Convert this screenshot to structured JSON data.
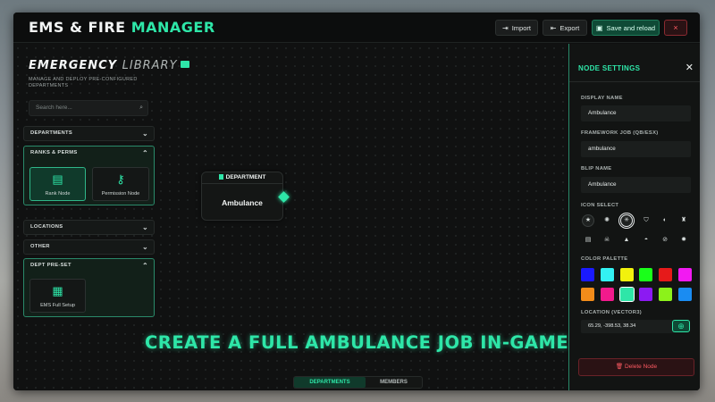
{
  "header": {
    "title_main": "EMS & FIRE",
    "title_accent": "MANAGER",
    "import_label": "Import",
    "export_label": "Export",
    "save_label": "Save and reload",
    "close_label": "×"
  },
  "library": {
    "title_bold": "EMERGENCY",
    "title_thin": "LIBRARY",
    "subtitle": "MANAGE AND DEPLOY PRE-CONFIGURED DEPARTMENTS",
    "search_placeholder": "Search here...",
    "sections": [
      {
        "label": "DEPARTMENTS",
        "open": false
      },
      {
        "label": "RANKS & PERMS",
        "open": true,
        "tiles": [
          {
            "label": "Rank Node",
            "icon": "badge-icon"
          },
          {
            "label": "Permission Node",
            "icon": "key-icon"
          }
        ]
      },
      {
        "label": "LOCATIONS",
        "open": false
      },
      {
        "label": "OTHER",
        "open": false
      },
      {
        "label": "DEPT PRE-SET",
        "open": true,
        "tiles": [
          {
            "label": "EMS Full Setup",
            "icon": "building-check-icon"
          }
        ]
      }
    ]
  },
  "node": {
    "header": "DEPARTMENT",
    "name": "Ambulance"
  },
  "caption": "CREATE A FULL AMBULANCE JOB IN-GAME",
  "settings": {
    "title": "NODE SETTINGS",
    "close": "✕",
    "display_name_label": "DISPLAY NAME",
    "display_name_value": "Ambulance",
    "framework_job_label": "FRAMEWORK JOB (QB/ESX)",
    "framework_job_value": "ambulance",
    "blip_name_label": "BLIP NAME",
    "blip_name_value": "Ambulance",
    "icon_select_label": "ICON SELECT",
    "icons": [
      "star-badge-icon",
      "gear-icon",
      "ambulance-icon",
      "shield-icon",
      "half-shield-icon",
      "crown-icon",
      "document-icon",
      "skull-icon",
      "alert-triangle-icon",
      "helmet-icon",
      "pills-icon",
      "cog-icon"
    ],
    "selected_icon": 2,
    "color_palette_label": "COLOR PALETTE",
    "colors": [
      "#1a1aff",
      "#33f2f2",
      "#f2f20d",
      "#1aff1a",
      "#e61a1a",
      "#f21af2",
      "#f28c1a",
      "#f21a8c",
      "#2ee6a8",
      "#8c1af2",
      "#8cf21a",
      "#1a8cf2"
    ],
    "selected_color": 8,
    "location_label": "LOCATION (VECTOR3)",
    "location_value": "65.29, -398.53, 38.34",
    "delete_label": "Delete Node"
  },
  "tabs": {
    "departments": "DEPARTMENTS",
    "members": "MEMBERS"
  }
}
